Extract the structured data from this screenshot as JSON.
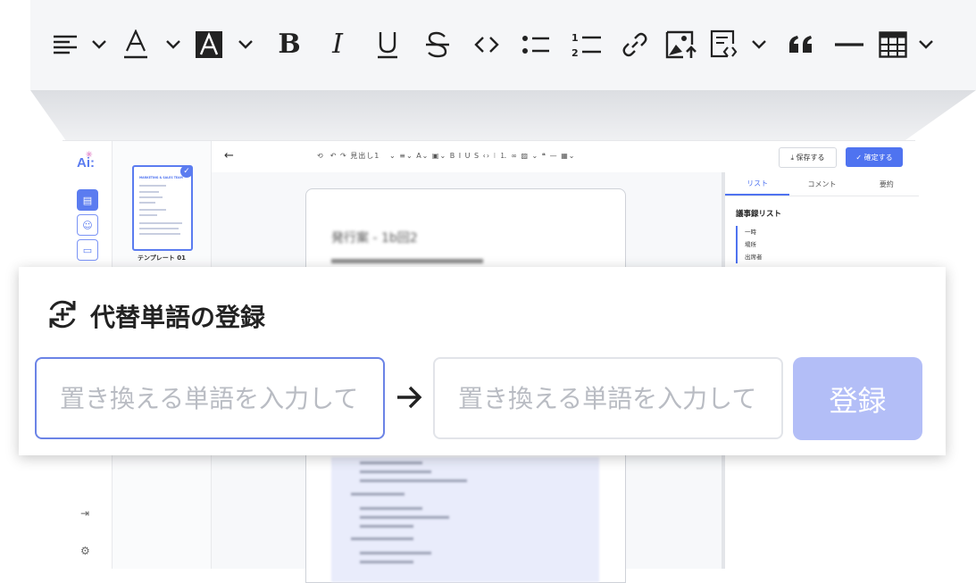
{
  "zoom_toolbar": {
    "icons": [
      "align-left-icon",
      "chevron-down-icon",
      "text-color-icon",
      "chevron-down-icon",
      "highlight-icon",
      "chevron-down-icon",
      "bold-icon",
      "italic-icon",
      "underline-icon",
      "strikethrough-icon",
      "code-icon",
      "bullet-list-icon",
      "numbered-list-icon",
      "link-icon",
      "image-upload-icon",
      "template-icon",
      "chevron-down-icon",
      "quote-icon",
      "horizontal-rule-icon",
      "table-icon",
      "chevron-down-icon"
    ]
  },
  "app": {
    "logo": "Ai:",
    "template": {
      "label": "テンプレート 01",
      "card_heading": "MARKETING & SALES TEAM"
    },
    "toolbar": {
      "heading_select": "見出し1"
    },
    "actions": {
      "save": "保存する",
      "confirm": "確定する"
    },
    "document": {
      "heading": "発行案 - 1b回2"
    },
    "right_panel": {
      "tabs": [
        "リスト",
        "コメント",
        "要約"
      ],
      "active_tab": "リスト",
      "title": "議事録リスト",
      "items": [
        "一時",
        "場所",
        "出席者"
      ]
    }
  },
  "dialog": {
    "title": "代替単語の登録",
    "source_field": {
      "placeholder": "置き換える単語を入力して",
      "value": ""
    },
    "target_field": {
      "placeholder": "置き換える単語を入力して",
      "value": ""
    },
    "arrow": "→",
    "register_button": "登録",
    "colors": {
      "accent": "#6b83e6",
      "button_disabled": "#b3bef7"
    }
  }
}
